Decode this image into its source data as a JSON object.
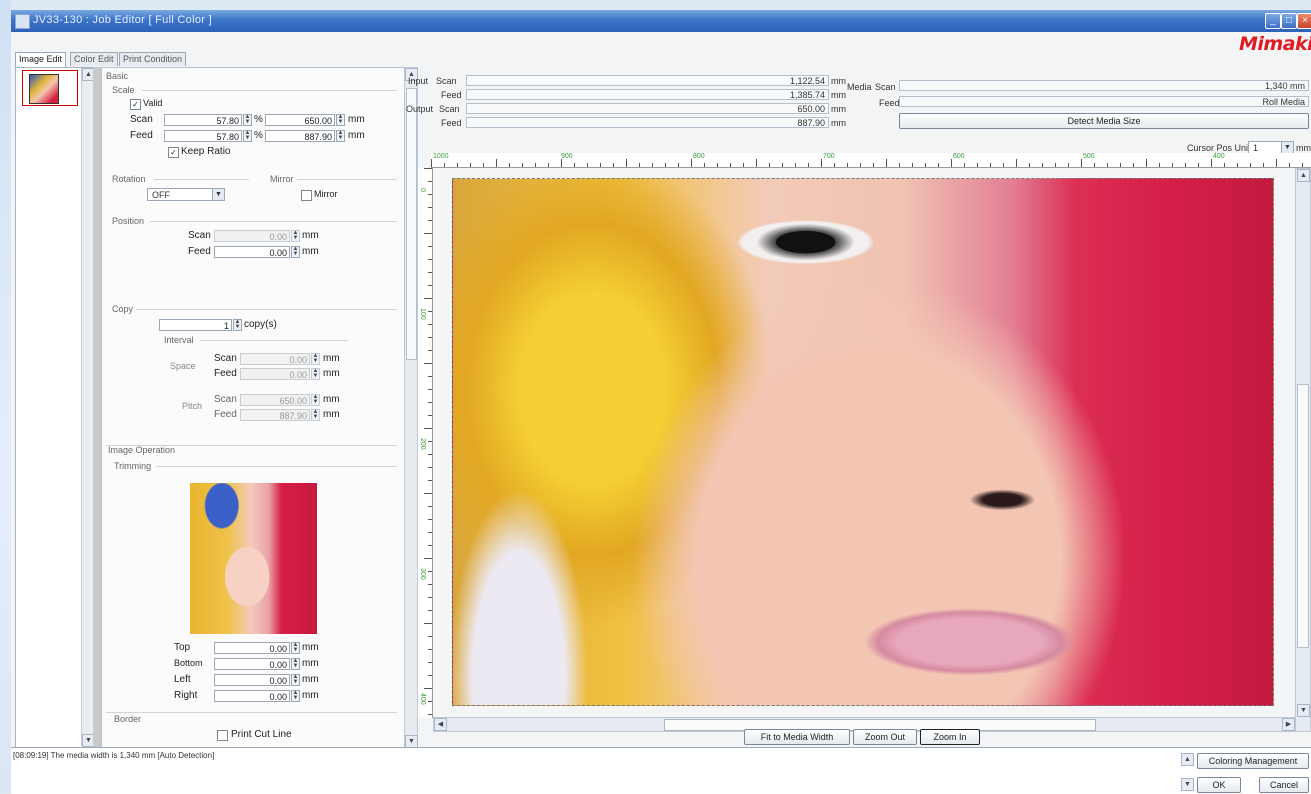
{
  "window": {
    "title": "JV33-130 : Job Editor [ Full Color ]",
    "brand": "Mimaki",
    "brand_color": "#e11b22"
  },
  "tabs": [
    "Image Edit",
    "Color Edit",
    "Print Condition"
  ],
  "settings": {
    "basic_label": "Basic",
    "scale": {
      "label": "Scale",
      "valid_label": "Valid",
      "valid_checked": true,
      "scan_label": "Scan",
      "scan_percent": "57.80",
      "scan_mm": "650.00",
      "feed_label": "Feed",
      "feed_percent": "57.80",
      "feed_mm": "887.90",
      "keep_ratio_label": "Keep Ratio",
      "keep_ratio_checked": true,
      "percent_unit": "%",
      "mm_unit": "mm"
    },
    "rotation": {
      "label": "Rotation",
      "value": "OFF"
    },
    "mirror": {
      "label": "Mirror",
      "option_label": "Mirror",
      "checked": false
    },
    "position": {
      "label": "Position",
      "scan_label": "Scan",
      "scan_value": "0.00",
      "feed_label": "Feed",
      "feed_value": "0.00",
      "unit": "mm"
    },
    "copy": {
      "label": "Copy",
      "count": "1",
      "unit": "copy(s)",
      "interval_label": "Interval",
      "space_label": "Space",
      "space_scan_label": "Scan",
      "space_scan": "0.00",
      "space_feed_label": "Feed",
      "space_feed": "0.00",
      "pitch_label": "Pitch",
      "pitch_scan_label": "Scan",
      "pitch_scan": "650.00",
      "pitch_feed_label": "Feed",
      "pitch_feed": "887.90",
      "mm_unit": "mm"
    },
    "image_operation_label": "Image Operation",
    "trimming": {
      "label": "Trimming",
      "top_label": "Top",
      "top": "0.00",
      "bottom_label": "Bottom",
      "bottom": "0.00",
      "left_label": "Left",
      "left": "0.00",
      "right_label": "Right",
      "right": "0.00",
      "unit": "mm"
    },
    "border_label": "Border",
    "print_cut_line_label": "Print Cut Line"
  },
  "info": {
    "input_label": "Input",
    "input_scan_label": "Scan",
    "input_scan": "1,122.54",
    "input_feed_label": "Feed",
    "input_feed": "1,385.74",
    "output_label": "Output",
    "output_scan_label": "Scan",
    "output_scan": "650.00",
    "output_feed_label": "Feed",
    "output_feed": "887.90",
    "mm_unit": "mm",
    "media_label": "Media",
    "media_scan_label": "Scan",
    "media_scan": "1,340 mm",
    "media_feed_label": "Feed",
    "media_feed": "Roll Media",
    "detect_media_label": "Detect Media Size",
    "cursor_pos_unit_label": "Cursor Pos Unit",
    "cursor_pos_unit_value": "1",
    "cursor_pos_unit_suffix": "mm"
  },
  "ruler": {
    "h_labels": [
      "1000",
      "900",
      "800",
      "700",
      "600",
      "500",
      "400"
    ],
    "v_labels": [
      "0",
      "100",
      "200",
      "300",
      "400"
    ]
  },
  "view_buttons": {
    "fit_media": "Fit to Media Width",
    "zoom_out": "Zoom Out",
    "zoom_in": "Zoom In"
  },
  "status": {
    "message": "[08:09:19] The media width is 1,340 mm [Auto Detection]"
  },
  "bottom_buttons": {
    "color_management": "Coloring Management",
    "ok": "OK",
    "cancel": "Cancel"
  }
}
